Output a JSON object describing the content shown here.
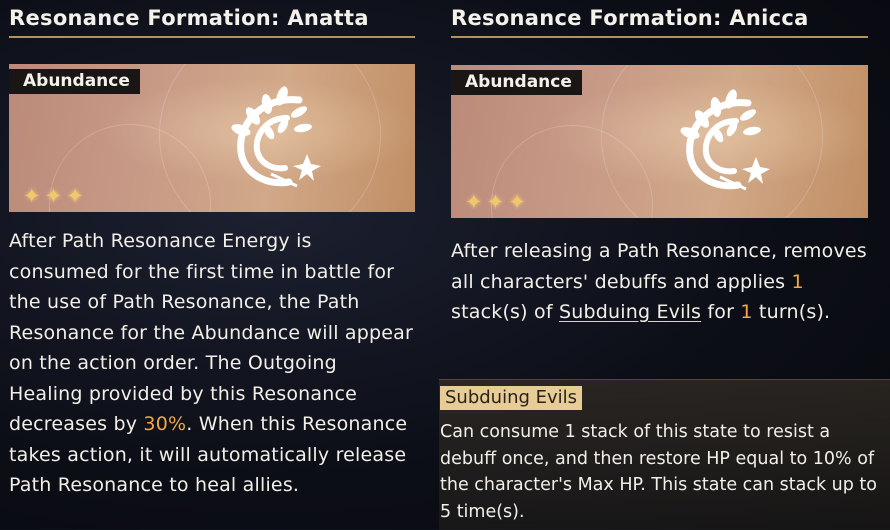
{
  "left": {
    "title": "Resonance Formation: Anatta",
    "tag": "Abundance",
    "stars": "✦✦✦",
    "desc": {
      "part1": "After Path Resonance Energy is consumed for the first time in battle for the use of Path Resonance, the Path Resonance for the Abundance will appear on the action order. The Outgoing Healing provided by this Resonance decreases by ",
      "highlight": "30%",
      "part2": ". When this Resonance takes action, it will automatically release Path Resonance to heal allies."
    }
  },
  "right": {
    "title": "Resonance Formation: Anicca",
    "tag": "Abundance",
    "stars": "✦✦✦",
    "desc": {
      "part1": "After releasing a Path Resonance, removes all characters' debuffs and applies ",
      "stacks": "1",
      "part2": " stack(s) of ",
      "term": "Subduing Evils",
      "part3": " for ",
      "turns": "1",
      "part4": " turn(s)."
    }
  },
  "status": {
    "name": "Subduing Evils",
    "text": "Can consume 1 stack of this state to resist a debuff once, and then restore HP equal to 10% of the character's Max HP. This state can stack up to 5 time(s)."
  },
  "icons": {
    "path_emblem": "abundance-wheat-emblem-icon",
    "rarity": "star-icon"
  },
  "colors": {
    "accent": "#f0a845",
    "rule": "#b3925e",
    "star": "#f2c76a",
    "status_tag": "#e8cc96"
  }
}
